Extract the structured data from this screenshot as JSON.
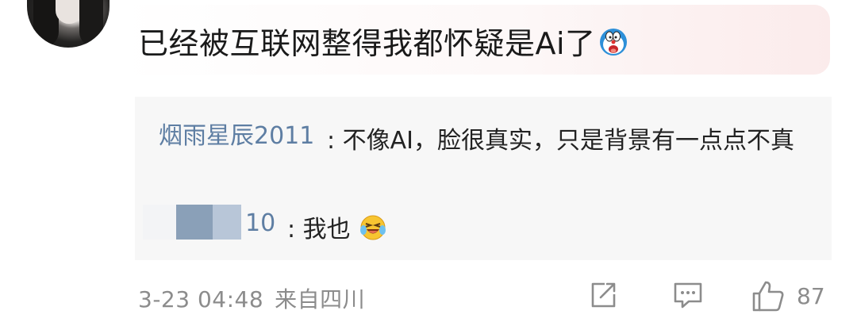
{
  "comment": {
    "text": "已经被互联网整得我都怀疑是Ai了",
    "emoji_icon": "doraemon-emoji-icon"
  },
  "replies": [
    {
      "user": "烟雨星辰2011",
      "separator": ":",
      "text": "不像AI，脸很真实，只是背景有一点点不真"
    },
    {
      "user_visible_tail": "10",
      "separator": ":",
      "text": "我也",
      "emoji_icon": "laughing-tears-emoji-icon"
    }
  ],
  "footer": {
    "timestamp": "3-23 04:48",
    "location": "来自四川",
    "like_count": "87",
    "icons": [
      "share-icon",
      "reply-icon",
      "like-icon"
    ]
  },
  "colors": {
    "username": "#5e7ea3",
    "text": "#1a1a1a",
    "meta": "#8c8c8c",
    "reply_bg": "#f7f7f7"
  }
}
